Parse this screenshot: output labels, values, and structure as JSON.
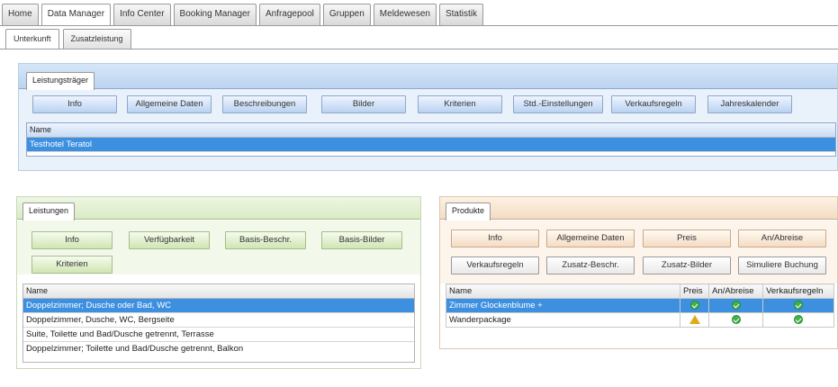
{
  "topnav": {
    "tabs": [
      "Home",
      "Data Manager",
      "Info Center",
      "Booking Manager",
      "Anfragepool",
      "Gruppen",
      "Meldewesen",
      "Statistik"
    ]
  },
  "subnav": {
    "tabs": [
      "Unterkunft",
      "Zusatzleistung"
    ]
  },
  "leistungstraeger": {
    "tab_label": "Leistungsträger",
    "buttons": [
      "Info",
      "Allgemeine Daten",
      "Beschreibungen",
      "Bilder",
      "Kriterien",
      "Std.-Einstellungen",
      "Verkaufsregeln",
      "Jahreskalender"
    ],
    "list_header": "Name",
    "rows": [
      "Testhotel Teratol"
    ]
  },
  "leistungen": {
    "tab_label": "Leistungen",
    "buttons_row1": [
      "Info",
      "Verfügbarkeit",
      "Basis-Beschr.",
      "Basis-Bilder"
    ],
    "buttons_row2": [
      "Kriterien"
    ],
    "list_header": "Name",
    "rows": [
      "Doppelzimmer; Dusche oder Bad, WC",
      "Doppelzimmer, Dusche, WC, Bergseite",
      "Suite, Toilette und Bad/Dusche getrennt, Terrasse",
      "Doppelzimmer; Toilette und Bad/Dusche getrennt, Balkon"
    ]
  },
  "produkte": {
    "tab_label": "Produkte",
    "buttons_row1": [
      "Info",
      "Allgemeine Daten",
      "Preis",
      "An/Abreise"
    ],
    "buttons_row2": [
      "Verkaufsregeln",
      "Zusatz-Beschr.",
      "Zusatz-Bilder",
      "Simuliere Buchung"
    ],
    "columns": [
      "Name",
      "Preis",
      "An/Abreise",
      "Verkaufsregeln"
    ],
    "rows": [
      {
        "name": "Zimmer Glockenblume +",
        "preis": "ok",
        "anabreise": "ok",
        "verkaufsregeln": "ok"
      },
      {
        "name": "Wanderpackage",
        "preis": "warning",
        "anabreise": "ok",
        "verkaufsregeln": "ok"
      }
    ]
  },
  "colors": {
    "selection": "#3d8fe0",
    "blue_panel": "#dbe8f8",
    "green_panel": "#e8f3dc",
    "orange_panel": "#fcecdc"
  }
}
